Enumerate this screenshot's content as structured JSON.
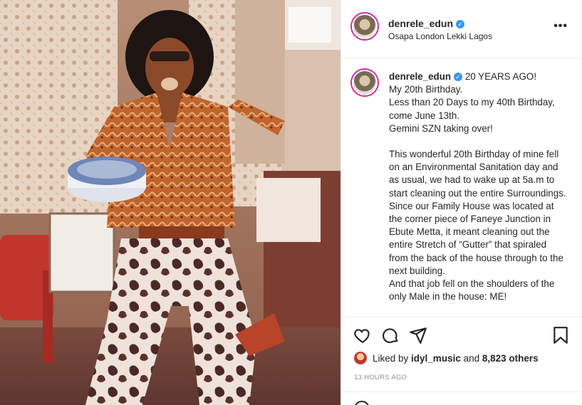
{
  "post": {
    "username": "denrele_edun",
    "location": "Osapa London Lekki Lagos",
    "more_label": "•••",
    "verified_mark": "✓"
  },
  "caption": {
    "username": "denrele_edun",
    "lines": [
      "20 YEARS AGO!",
      "My 20th Birthday.",
      "Less than 20 Days to my 40th Birthday, come June 13th.",
      "Gemini SZN taking over!",
      "",
      "This wonderful 20th Birthday of mine fell on an Environmental Sanitation day and as usual, we had to wake up at 5a.m to start cleaning out the entire Surroundings.",
      "Since our Family House was located at the corner piece of Faneye Junction in Ebute Metta, it meant cleaning out the entire Stretch of “Gutter” that spiraled from the back of the house through to the next building.",
      "And that job fell on the shoulders of the only Male in the house: ME!"
    ]
  },
  "actions": {
    "like_icon": "heart-icon",
    "comment_icon": "comment-icon",
    "share_icon": "share-icon",
    "save_icon": "bookmark-icon"
  },
  "likes": {
    "prefix": "Liked by ",
    "user": "idyl_music",
    "middle": " and ",
    "count": "8,823 others"
  },
  "timestamp": "13 HOURS AGO"
}
